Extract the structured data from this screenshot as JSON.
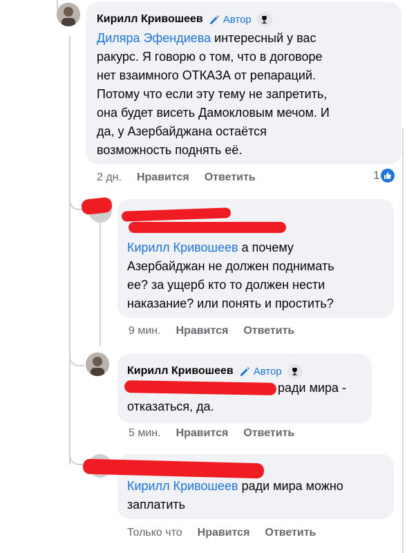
{
  "comment1": {
    "author": "Кирилл Кривошеев",
    "badge": "Автор",
    "mention": "Диляра Эфендиева",
    "lines": [
      "интересный у вас",
      "ракурс. Я говорю о том, что в договоре",
      "нет взаимного ОТКАЗА от репараций.",
      "Потому что если эту тему не запретить,",
      "она будет висеть Дамокловым мечом. И",
      "да, у Азербайджана остаётся",
      "возможность поднять её."
    ],
    "time": "2 дн.",
    "like": "Нравится",
    "reply": "Ответить",
    "reaction_count": "1"
  },
  "comment2": {
    "mention": "Кирилл Кривошеев",
    "lines": [
      "а почему",
      "Азербайджан не должен поднимать",
      "ее? за ущерб кто то должен нести",
      "наказание? или понять и простить?"
    ],
    "time": "9 мин.",
    "like": "Нравится",
    "reply": "Ответить"
  },
  "comment3": {
    "author": "Кирилл Кривошеев",
    "badge": "Автор",
    "lines": [
      "ради мира -",
      "отказаться, да."
    ],
    "time": "5 мин.",
    "like": "Нравится",
    "reply": "Ответить"
  },
  "comment4": {
    "mention": "Кирилл Кривошеев",
    "lines": [
      "ради мира можно",
      "заплатить"
    ],
    "time": "Только что",
    "like": "Нравится",
    "reply": "Ответить"
  },
  "colors": {
    "accent": "#1b74e4",
    "bubble": "#f0f2f5",
    "redaction": "#ef1c23",
    "muted": "#65676b"
  }
}
